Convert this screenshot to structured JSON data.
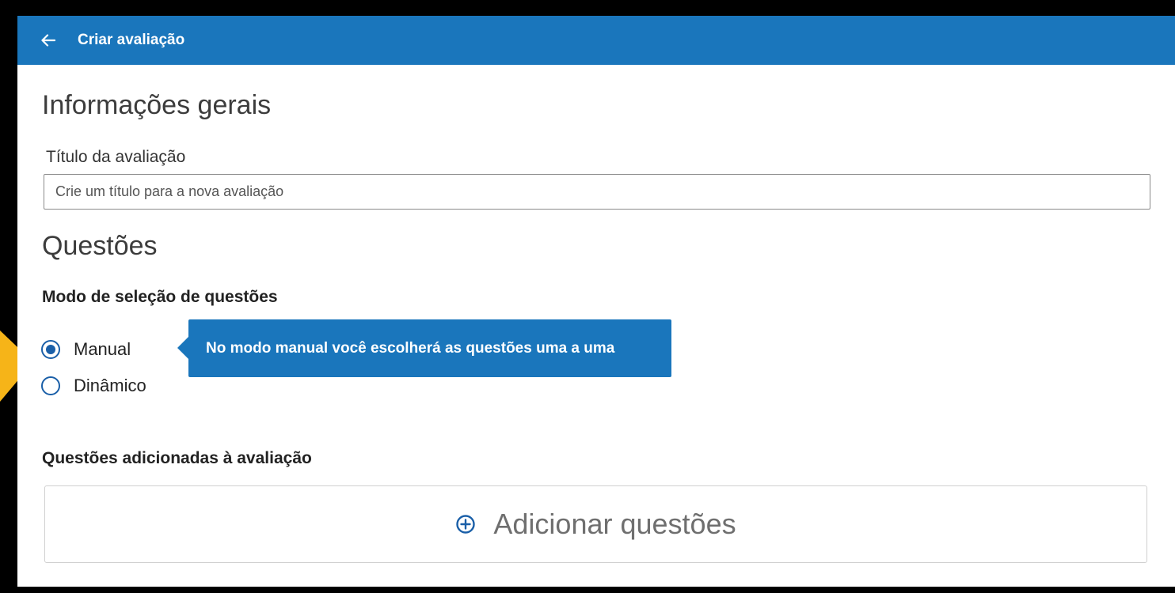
{
  "header": {
    "title": "Criar avaliação",
    "back_icon": "arrow-left-icon"
  },
  "general": {
    "section_title": "Informações gerais",
    "title_label": "Título da avaliação",
    "title_value": "",
    "title_placeholder": "Crie um título para a nova avaliação"
  },
  "questions": {
    "section_title": "Questões",
    "mode_label": "Modo de seleção de questões",
    "options": [
      {
        "label": "Manual",
        "selected": true
      },
      {
        "label": "Dinâmico",
        "selected": false
      }
    ],
    "tooltip": "No modo manual você escolherá as questões uma a uma",
    "added_label": "Questões adicionadas à avaliação",
    "add_button_label": "Adicionar questões",
    "add_icon": "plus-circle-icon"
  },
  "colors": {
    "primary": "#1a76bc",
    "radio": "#1a5fa8",
    "pointer_accent": "#f6b418",
    "frame": "#000000"
  }
}
